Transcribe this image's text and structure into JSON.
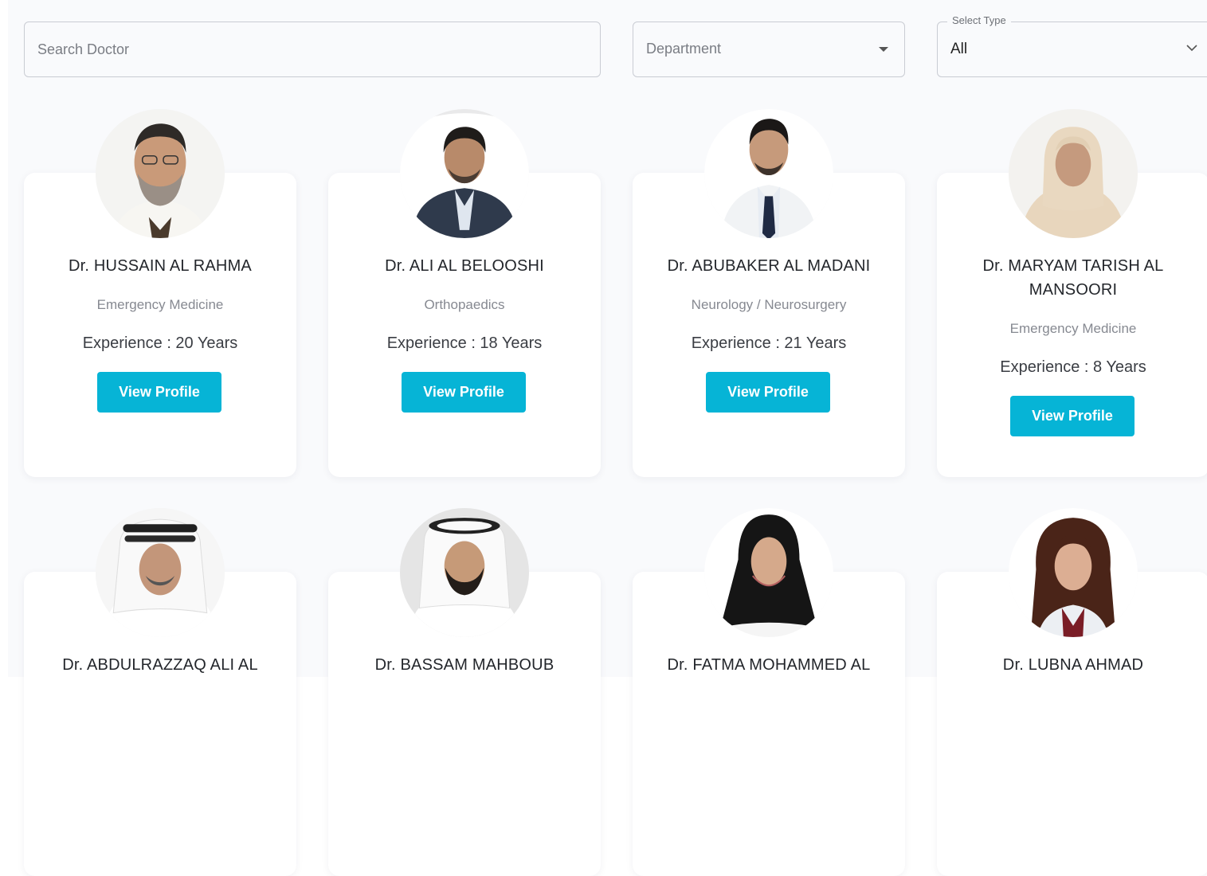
{
  "filters": {
    "search_placeholder": "Search Doctor",
    "department_placeholder": "Department",
    "type_legend": "Select Type",
    "type_value": "All"
  },
  "button_label": "View Profile",
  "doctors": [
    {
      "name": "Dr. HUSSAIN AL RAHMA",
      "department": "Emergency Medicine",
      "experience": "Experience : 20 Years"
    },
    {
      "name": "Dr. ALI AL BELOOSHI",
      "department": "Orthopaedics",
      "experience": "Experience : 18 Years"
    },
    {
      "name": "Dr. ABUBAKER AL MADANI",
      "department": "Neurology / Neurosurgery",
      "experience": "Experience : 21 Years"
    },
    {
      "name": "Dr. MARYAM TARISH AL MANSOORI",
      "department": "Emergency Medicine",
      "experience": "Experience : 8 Years"
    },
    {
      "name": "Dr. ABDULRAZZAQ ALI AL"
    },
    {
      "name": "Dr. BASSAM MAHBOUB"
    },
    {
      "name": "Dr. FATMA MOHAMMED AL"
    },
    {
      "name": "Dr. LUBNA AHMAD"
    }
  ],
  "colors": {
    "accent": "#06b4d6",
    "background": "#f9fafc",
    "card": "#ffffff"
  }
}
